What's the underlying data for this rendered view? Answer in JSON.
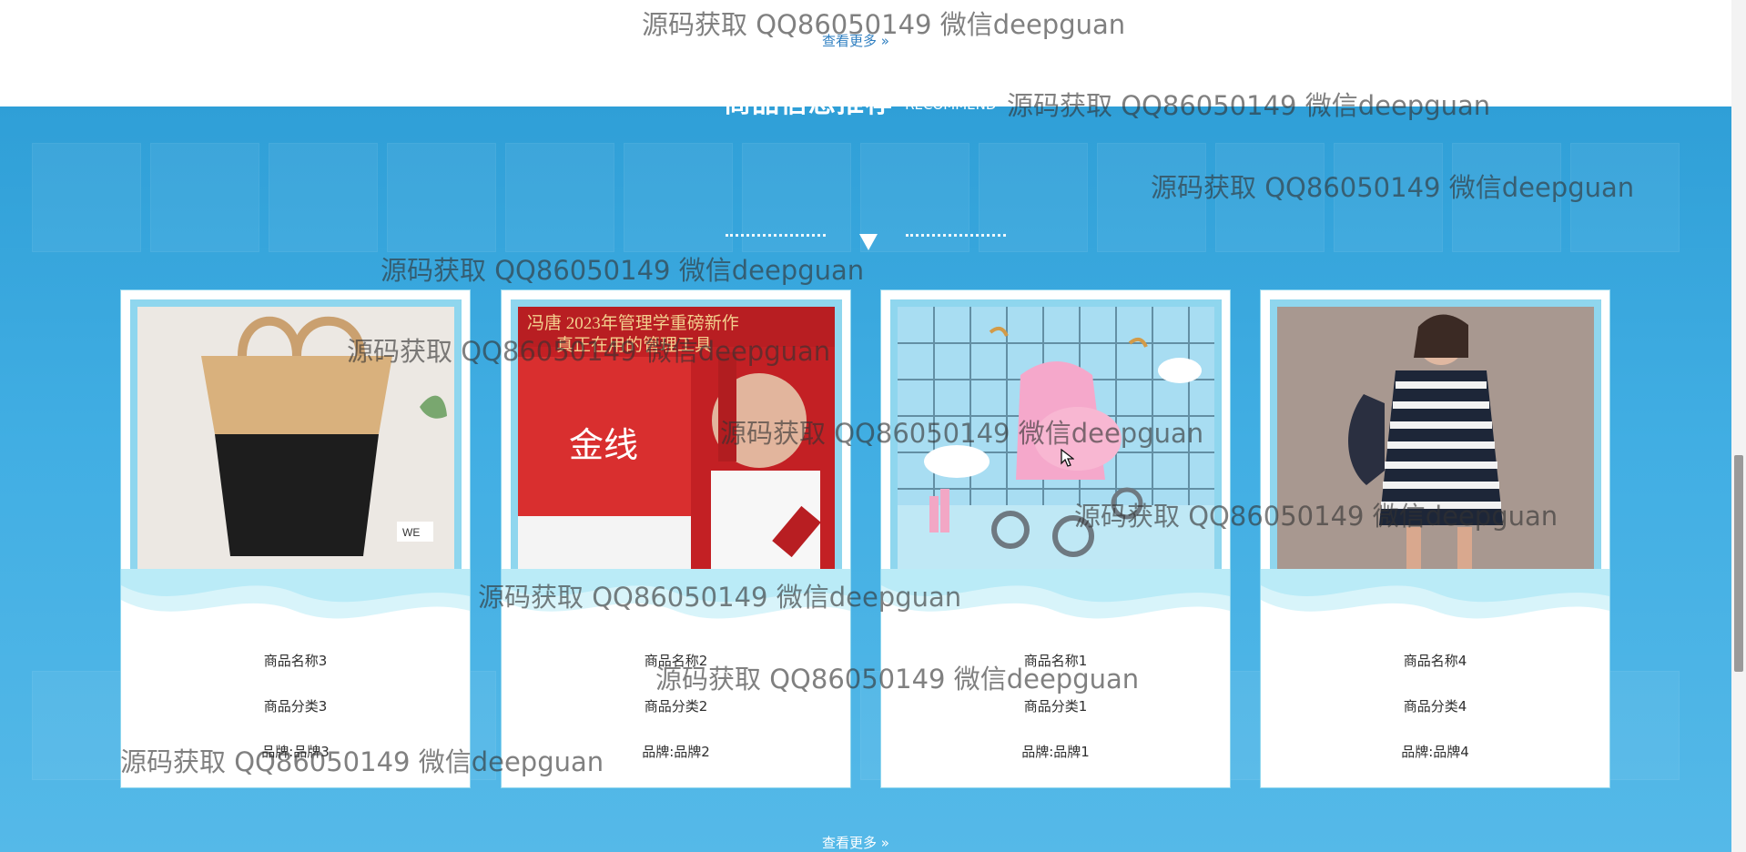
{
  "top": {
    "more_label": "查看更多 »"
  },
  "section": {
    "title": "商品信息推荐",
    "subtitle": "RECOMMEND",
    "bottom_more_label": "查看更多 »"
  },
  "products": [
    {
      "name": "商品名称3",
      "category": "商品分类3",
      "brand": "品牌:品牌3",
      "image": "basket-bag-photo"
    },
    {
      "name": "商品名称2",
      "category": "商品分类2",
      "brand": "品牌:品牌2",
      "image": "book-cover-photo"
    },
    {
      "name": "商品名称1",
      "category": "商品分类1",
      "brand": "品牌:品牌1",
      "image": "pink-stroller-photo"
    },
    {
      "name": "商品名称4",
      "category": "商品分类4",
      "brand": "品牌:品牌4",
      "image": "striped-dress-photo"
    }
  ],
  "watermarks": [
    "源码获取 QQ86050149 微信deepguan",
    "源码获取 QQ86050149 微信deepguan",
    "源码获取 QQ86050149 微信deepguan",
    "源码获取 QQ86050149 微信deepguan",
    "源码获取 QQ86050149 微信deepguan",
    "源码获取 QQ86050149 微信deepguan",
    "源码获取 QQ86050149 微信deepguan",
    "源码获取 QQ86050149 微信deepguan",
    "源码获取 QQ86050149 微信deepguan",
    "源码获取 QQ86050149 微信deepguan"
  ],
  "book_cover": {
    "headline": "冯唐 2023年管理学重磅新作",
    "line2": "真正在用的管理工具",
    "title": "金线"
  }
}
